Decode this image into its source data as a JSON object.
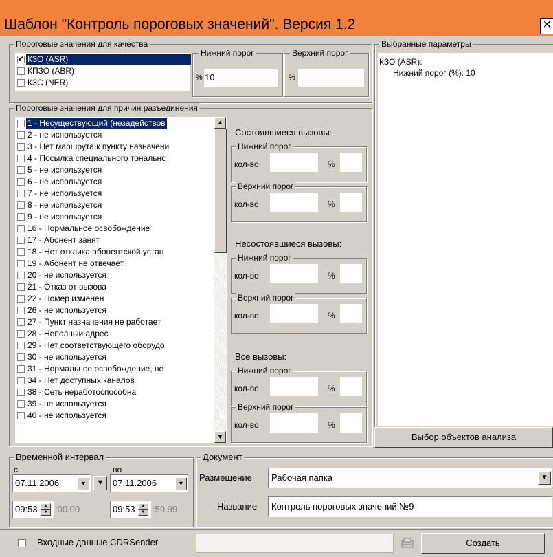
{
  "window": {
    "title": "Шаблон \"Контроль пороговых значений\". Версия 1.2",
    "close_glyph": "✕",
    "titlebar_color": "#f0823c"
  },
  "quality": {
    "group_label": "Пороговые значения для качества",
    "items": [
      {
        "label": "КЗО (ASR)",
        "checked": true,
        "selected": true
      },
      {
        "label": "КПЗО (ABR)",
        "checked": false,
        "selected": false
      },
      {
        "label": "КЗС (NER)",
        "checked": false,
        "selected": false
      }
    ],
    "lower_label": "Нижний порог",
    "upper_label": "Верхний порог",
    "percent_sign": "%",
    "lower_value": "10",
    "upper_value": ""
  },
  "selected_params": {
    "group_label": "Выбранные параметры",
    "line1": "КЗО (ASR):",
    "line2": "Нижний порог (%): 10"
  },
  "disconnect": {
    "group_label": "Пороговые значения для причин разъединения",
    "items": [
      "1 - Несуществующий (незадействов",
      "2 - не используется",
      "3 - Нет маршрута к пункту назначени",
      "4 - Посылка специального тональнс",
      "5 - не используется",
      "6 - не используется",
      "7 - не используется",
      "8 - не используется",
      "9 - не используется",
      "16 - Нормальное освобождение",
      "17 - Абонент занят",
      "18 - Нет отклика абонентской устан",
      "19 - Абонент не отвечает",
      "20 - не используется",
      "21 - Отказ от вызова",
      "22 - Номер изменен",
      "26 - не используется",
      "27 - Пункт назначения не работает",
      "28 - Неполный адрес",
      "29 - Нет соответствующего оборудо",
      "30 - не используется",
      "31 - Нормальное освобождение, не",
      "34 - Нет доступных каналов",
      "38 - Сеть неработоспособна",
      "39 - не используется",
      "40 - не используется"
    ],
    "scroll_up": "▲",
    "scroll_down": "▼"
  },
  "calls": {
    "successful_label": "Состоявшиеся вызовы:",
    "failed_label": "Несостоявшиеся вызовы:",
    "all_label": "Все вызовы:",
    "lower_label": "Нижний порог",
    "upper_label": "Верхний порог",
    "count_label": "кол-во",
    "percent_sign": "%"
  },
  "analysis_button": "Выбор объектов анализа",
  "interval": {
    "group_label": "Временной интервал",
    "from_label": "с",
    "to_label": "по",
    "from_date": "07.11.2006",
    "to_date": "07.11.2006",
    "from_time": "09:53",
    "from_seconds": ":00.00",
    "to_time": "09:53",
    "to_seconds": ":59.99",
    "dropdown_glyph": "▼"
  },
  "document": {
    "group_label": "Документ",
    "placement_label": "Размещение",
    "placement_value": "Рабочая папка",
    "name_label": "Название",
    "name_value": "Контроль пороговых значений №9"
  },
  "footer": {
    "cdr_label": "Входные данные CDRSender",
    "create_label": "Создать"
  }
}
